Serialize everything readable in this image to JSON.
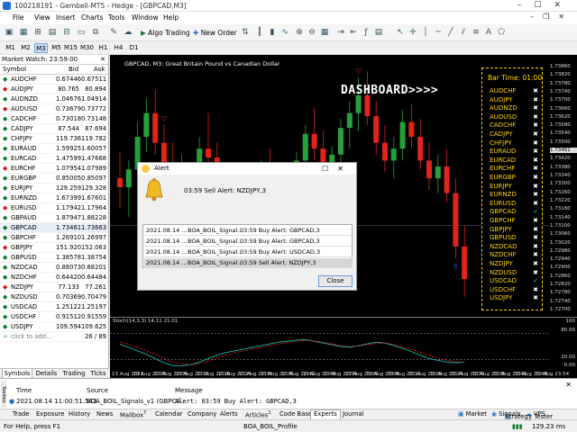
{
  "window": {
    "title": "100218191 - Gembell-MT5 - Hedge - [GBPCAD,M3]"
  },
  "menu": [
    "File",
    "View",
    "Insert",
    "Charts",
    "Tools",
    "Window",
    "Help"
  ],
  "toolbar": {
    "algo_label": "Algo Trading",
    "neworder_label": "New Order"
  },
  "timeframes": [
    "M1",
    "M2",
    "M3",
    "M5",
    "M15",
    "M30",
    "H1",
    "H4",
    "D1"
  ],
  "timeframe_selected": "M3",
  "market_watch": {
    "title": "Market Watch: 23:59:00",
    "col_symbol": "Symbol",
    "col_bid": "Bid",
    "col_ask": "Ask",
    "rows": [
      {
        "sym": "AUDCHF",
        "bid": "0.67446",
        "ask": "0.67511",
        "dir": "up"
      },
      {
        "sym": "AUDJPY",
        "bid": "80.765",
        "ask": "80.894",
        "dir": "dn"
      },
      {
        "sym": "AUDNZD",
        "bid": "1.04676",
        "ask": "1.04914",
        "dir": "up"
      },
      {
        "sym": "AUDUSD",
        "bid": "0.73679",
        "ask": "0.73772",
        "dir": "dn"
      },
      {
        "sym": "CADCHF",
        "bid": "0.73018",
        "ask": "0.73148",
        "dir": "up"
      },
      {
        "sym": "CADJPY",
        "bid": "87.544",
        "ask": "87.694",
        "dir": "up"
      },
      {
        "sym": "CHFJPY",
        "bid": "119.736",
        "ask": "119.782",
        "dir": "up"
      },
      {
        "sym": "EURAUD",
        "bid": "1.59925",
        "ask": "1.60057",
        "dir": "up"
      },
      {
        "sym": "EURCAD",
        "bid": "1.47599",
        "ask": "1.47668",
        "dir": "up"
      },
      {
        "sym": "EURCHF",
        "bid": "1.07954",
        "ask": "1.07989",
        "dir": "dn"
      },
      {
        "sym": "EURGBP",
        "bid": "0.85005",
        "ask": "0.85097",
        "dir": "up"
      },
      {
        "sym": "EURJPY",
        "bid": "129.259",
        "ask": "129.328",
        "dir": "up"
      },
      {
        "sym": "EURNZD",
        "bid": "1.67399",
        "ask": "1.67601",
        "dir": "up"
      },
      {
        "sym": "EURUSD",
        "bid": "1.17942",
        "ask": "1.17964",
        "dir": "dn"
      },
      {
        "sym": "GBPAUD",
        "bid": "1.87947",
        "ask": "1.88228",
        "dir": "up"
      },
      {
        "sym": "GBPCAD",
        "bid": "1.73461",
        "ask": "1.73663",
        "dir": "up"
      },
      {
        "sym": "GBPCHF",
        "bid": "1.26910",
        "ask": "1.26997",
        "dir": "up"
      },
      {
        "sym": "GBPJPY",
        "bid": "151.920",
        "ask": "152.063",
        "dir": "dn"
      },
      {
        "sym": "GBPUSD",
        "bid": "1.38578",
        "ask": "1.38754",
        "dir": "up"
      },
      {
        "sym": "NZDCAD",
        "bid": "0.88073",
        "ask": "0.88201",
        "dir": "up"
      },
      {
        "sym": "NZDCHF",
        "bid": "0.64420",
        "ask": "0.64484",
        "dir": "up"
      },
      {
        "sym": "NZDJPY",
        "bid": "77.133",
        "ask": "77.261",
        "dir": "dn"
      },
      {
        "sym": "NZDUSD",
        "bid": "0.70369",
        "ask": "0.70479",
        "dir": "up"
      },
      {
        "sym": "USDCAD",
        "bid": "1.25122",
        "ask": "1.25197",
        "dir": "up"
      },
      {
        "sym": "USDCHF",
        "bid": "0.91512",
        "ask": "0.91559",
        "dir": "up"
      },
      {
        "sym": "USDJPY",
        "bid": "109.594",
        "ask": "109.625",
        "dir": "up"
      }
    ],
    "add_label": "click to add...",
    "count": "26 / 89",
    "tabs": [
      "Symbols",
      "Details",
      "Trading",
      "Ticks"
    ]
  },
  "chart": {
    "title": "GBPCAD, M3:  Great Britain Pound vs Canadian Dollar",
    "prices": [
      "1.73860",
      "1.73820",
      "1.73780",
      "1.73740",
      "1.73700",
      "1.73660",
      "1.73620",
      "1.73580",
      "1.73540",
      "1.73500",
      "1.73461",
      "1.73420",
      "1.73380",
      "1.73340",
      "1.73300",
      "1.73260",
      "1.73220",
      "1.73180",
      "1.73140",
      "1.73100",
      "1.73060",
      "1.73020",
      "1.72980",
      "1.72940",
      "1.72900",
      "1.72860",
      "1.72820",
      "1.72780",
      "1.72740",
      "1.72700"
    ],
    "times": [
      "13 Aug 2021",
      "13 Aug 22:00",
      "13 Aug 22:06",
      "13 Aug 22:12",
      "13 Aug 22:18",
      "13 Aug 22:24",
      "13 Aug 22:30",
      "13 Aug 22:36",
      "13 Aug 22:42",
      "13 Aug 22:48",
      "13 Aug 22:54",
      "13 Aug 23:00",
      "13 Aug 23:06",
      "13 Aug 23:12",
      "13 Aug 23:18",
      "13 Aug 23:24",
      "13 Aug 23:30",
      "13 Aug 23:36",
      "13 Aug 23:42",
      "13 Aug 23:48",
      "13 Aug 23:54"
    ],
    "stoch_title": "Stoch(14,3,3) 14.11 21.01",
    "stoch_levels": [
      "100",
      "80.00",
      "20.00",
      "0.00"
    ],
    "annotation": "DASHBOARD>>>>",
    "candles": [
      {
        "o": 1.7362,
        "h": 1.7371,
        "l": 1.7352,
        "c": 1.7359
      },
      {
        "o": 1.7359,
        "h": 1.7368,
        "l": 1.7349,
        "c": 1.7365
      },
      {
        "o": 1.7365,
        "h": 1.7381,
        "l": 1.736,
        "c": 1.7376
      },
      {
        "o": 1.7376,
        "h": 1.7389,
        "l": 1.7371,
        "c": 1.7384
      },
      {
        "o": 1.7384,
        "h": 1.7392,
        "l": 1.737,
        "c": 1.7374
      },
      {
        "o": 1.7374,
        "h": 1.738,
        "l": 1.7362,
        "c": 1.7366
      },
      {
        "o": 1.7366,
        "h": 1.7374,
        "l": 1.7358,
        "c": 1.7362
      },
      {
        "o": 1.7362,
        "h": 1.737,
        "l": 1.7354,
        "c": 1.7358
      },
      {
        "o": 1.7358,
        "h": 1.7367,
        "l": 1.7351,
        "c": 1.7363
      },
      {
        "o": 1.7363,
        "h": 1.7376,
        "l": 1.736,
        "c": 1.7372
      },
      {
        "o": 1.7372,
        "h": 1.7384,
        "l": 1.7366,
        "c": 1.7369
      },
      {
        "o": 1.7369,
        "h": 1.7374,
        "l": 1.7356,
        "c": 1.7359
      },
      {
        "o": 1.7359,
        "h": 1.7365,
        "l": 1.7346,
        "c": 1.735
      },
      {
        "o": 1.735,
        "h": 1.7358,
        "l": 1.7343,
        "c": 1.7354
      },
      {
        "o": 1.7354,
        "h": 1.7362,
        "l": 1.7348,
        "c": 1.7352
      },
      {
        "o": 1.7352,
        "h": 1.736,
        "l": 1.7345,
        "c": 1.7357
      },
      {
        "o": 1.7357,
        "h": 1.7368,
        "l": 1.7354,
        "c": 1.7364
      },
      {
        "o": 1.7364,
        "h": 1.7372,
        "l": 1.7358,
        "c": 1.7361
      },
      {
        "o": 1.7361,
        "h": 1.7366,
        "l": 1.735,
        "c": 1.7355
      },
      {
        "o": 1.7355,
        "h": 1.7363,
        "l": 1.7349,
        "c": 1.736
      },
      {
        "o": 1.736,
        "h": 1.7371,
        "l": 1.7356,
        "c": 1.7368
      },
      {
        "o": 1.7368,
        "h": 1.738,
        "l": 1.7364,
        "c": 1.7377
      },
      {
        "o": 1.7377,
        "h": 1.7386,
        "l": 1.7368,
        "c": 1.7372
      },
      {
        "o": 1.7372,
        "h": 1.7378,
        "l": 1.736,
        "c": 1.7364
      },
      {
        "o": 1.7364,
        "h": 1.7373,
        "l": 1.736,
        "c": 1.737
      },
      {
        "o": 1.737,
        "h": 1.7382,
        "l": 1.7366,
        "c": 1.7379
      },
      {
        "o": 1.7379,
        "h": 1.7388,
        "l": 1.7372,
        "c": 1.7384
      },
      {
        "o": 1.7384,
        "h": 1.7396,
        "l": 1.7378,
        "c": 1.739
      },
      {
        "o": 1.739,
        "h": 1.7398,
        "l": 1.738,
        "c": 1.7383
      },
      {
        "o": 1.7383,
        "h": 1.7388,
        "l": 1.737,
        "c": 1.7374
      },
      {
        "o": 1.7374,
        "h": 1.738,
        "l": 1.7364,
        "c": 1.7368
      },
      {
        "o": 1.7368,
        "h": 1.7376,
        "l": 1.7362,
        "c": 1.7372
      },
      {
        "o": 1.7372,
        "h": 1.7385,
        "l": 1.7368,
        "c": 1.7381
      },
      {
        "o": 1.7381,
        "h": 1.7387,
        "l": 1.7372,
        "c": 1.7376
      },
      {
        "o": 1.7376,
        "h": 1.7382,
        "l": 1.7365,
        "c": 1.7368
      },
      {
        "o": 1.7368,
        "h": 1.7374,
        "l": 1.7358,
        "c": 1.7362
      },
      {
        "o": 1.7362,
        "h": 1.737,
        "l": 1.7357,
        "c": 1.7366
      },
      {
        "o": 1.7366,
        "h": 1.7372,
        "l": 1.7354,
        "c": 1.7357
      },
      {
        "o": 1.7357,
        "h": 1.7362,
        "l": 1.7335,
        "c": 1.7339
      },
      {
        "o": 1.7339,
        "h": 1.7346,
        "l": 1.7322,
        "c": 1.7328
      }
    ],
    "signals": [
      {
        "i": 5,
        "t": "sell"
      },
      {
        "i": 15,
        "t": "sell"
      },
      {
        "i": 27,
        "t": "sell"
      },
      {
        "i": 38,
        "t": "buy"
      }
    ],
    "stoch_main": [
      55,
      48,
      40,
      32,
      22,
      12,
      6,
      5,
      8,
      14,
      22,
      30,
      36,
      40,
      44,
      48,
      52,
      56,
      60,
      62,
      65,
      66,
      62,
      58,
      54,
      50,
      48,
      52,
      56,
      60,
      58,
      52,
      46,
      38,
      30,
      22,
      18,
      14,
      12,
      14
    ],
    "stoch_signal": [
      60,
      55,
      48,
      40,
      32,
      22,
      14,
      9,
      8,
      10,
      16,
      24,
      30,
      36,
      40,
      44,
      48,
      52,
      56,
      59,
      62,
      64,
      63,
      60,
      56,
      52,
      50,
      51,
      54,
      57,
      58,
      55,
      50,
      43,
      36,
      29,
      23,
      18,
      15,
      14
    ]
  },
  "dashboard": {
    "bar_time": "Bar Time: 01:00",
    "items": [
      {
        "p": "AUDCHF",
        "s": "x"
      },
      {
        "p": "AUDJPY",
        "s": "x"
      },
      {
        "p": "AUDNZD",
        "s": "x"
      },
      {
        "p": "AUDUSD",
        "s": "x"
      },
      {
        "p": "CADCHF",
        "s": "x"
      },
      {
        "p": "CADJPY",
        "s": "x"
      },
      {
        "p": "CHFJPY",
        "s": "x"
      },
      {
        "p": "EURAUD",
        "s": "x"
      },
      {
        "p": "EURCAD",
        "s": "x"
      },
      {
        "p": "EURCHF",
        "s": "x"
      },
      {
        "p": "EURGBP",
        "s": "x"
      },
      {
        "p": "EURJPY",
        "s": "x"
      },
      {
        "p": "EURNZD",
        "s": "x"
      },
      {
        "p": "EURUSD",
        "s": "x"
      },
      {
        "p": "GBPCAD",
        "s": "check"
      },
      {
        "p": "GBPCHF",
        "s": "x"
      },
      {
        "p": "GBPJPY",
        "s": "x"
      },
      {
        "p": "GBPUSD",
        "s": "x"
      },
      {
        "p": "NZDCAD",
        "s": "x"
      },
      {
        "p": "NZDCHF",
        "s": "x"
      },
      {
        "p": "NZDJPY",
        "s": "x"
      },
      {
        "p": "NZDUSD",
        "s": "x"
      },
      {
        "p": "USDCAD",
        "s": "check"
      },
      {
        "p": "USDCHF",
        "s": "x"
      },
      {
        "p": "USDJPY",
        "s": "x"
      }
    ],
    "colors": {
      "label": "#ffd400",
      "x": "#ffffff",
      "check": "#3ee060"
    }
  },
  "alert": {
    "title": "Alert",
    "message": "03:59 Sell Alert: NZDJPY,3",
    "rows": [
      {
        "date": "2021.08.14 ...",
        "src": "BOA_BOIL_Signal...",
        "msg": "03:59 Buy Alert: GBPCAD,3"
      },
      {
        "date": "2021.08.14 ...",
        "src": "BOA_BOIL_Signal...",
        "msg": "03:59 Buy Alert: GBPCAD,3"
      },
      {
        "date": "2021.08.14 ...",
        "src": "BOA_BOIL_Signal...",
        "msg": "03:59 Buy Alert: USDCAD,3"
      },
      {
        "date": "2021.08.14 ...",
        "src": "BOA_BOIL_Signal...",
        "msg": "03:59 Sell Alert: NZDJPY,3"
      }
    ],
    "close_label": "Close"
  },
  "toolbox": {
    "col_time": "Time",
    "col_source": "Source",
    "col_message": "Message",
    "row": {
      "time": "2021.08.14 11:00:51.543",
      "source": "BOA_BOIL_Signals_v1 (GBPCA...",
      "message": "Alert: 03:59 Buy Alert: GBPCAD,3"
    },
    "tabs": [
      "Trade",
      "Exposure",
      "History",
      "News",
      "Mailbox",
      "Calendar",
      "Company",
      "Alerts",
      "Articles",
      "Code Base",
      "Experts",
      "Journal"
    ],
    "tab_badges": {
      "Mailbox": "7",
      "Articles": "1"
    },
    "selected_tab": "Experts",
    "right_items": [
      "Market",
      "Signals",
      "VPS",
      "Strategy Tester"
    ]
  },
  "statusbar": {
    "help": "For Help, press F1",
    "profile": "BOA_BOIL_Profile",
    "speed": "129.23 ms"
  }
}
